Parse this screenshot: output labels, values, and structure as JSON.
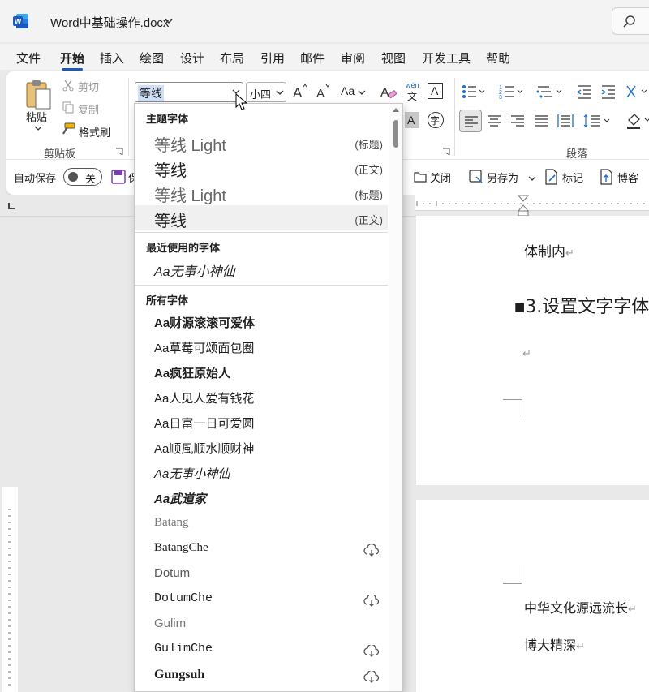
{
  "window": {
    "doc_title": "Word中基础操作.docx"
  },
  "menu": {
    "tabs": [
      "文件",
      "开始",
      "插入",
      "绘图",
      "设计",
      "布局",
      "引用",
      "邮件",
      "审阅",
      "视图",
      "开发工具",
      "帮助"
    ],
    "active_tab": "开始"
  },
  "clipboard": {
    "paste": "粘贴",
    "cut": "剪切",
    "copy": "复制",
    "format_painter": "格式刷",
    "group_label": "剪贴板"
  },
  "font": {
    "current_font": "等线",
    "current_size": "小四",
    "case_label": "Aa",
    "phonetic_top": "wén",
    "phonetic_bottom": "文",
    "border_char": "A",
    "shading_char": "A",
    "enclose_char": "字"
  },
  "paragraph": {
    "group_label": "段落"
  },
  "quickbar": {
    "autosave": "自动保存",
    "toggle_state": "关",
    "save_partial": "保",
    "close": "关闭",
    "save_as": "另存为",
    "mark": "标记",
    "blog": "博客"
  },
  "document": {
    "line1": "体制内",
    "heading": "3.设置文字字体",
    "line_para_mark": "↵",
    "line2": "中华文化源远流长",
    "line3": "博大精深"
  },
  "font_dropdown": {
    "theme_header": "主题字体",
    "theme_fonts": [
      {
        "name": "等线 Light",
        "tag": "(标题)"
      },
      {
        "name": "等线",
        "tag": "(正文)"
      },
      {
        "name": "等线 Light",
        "tag": "(标题)"
      },
      {
        "name": "等线",
        "tag": "(正文)"
      }
    ],
    "recent_header": "最近使用的字体",
    "recent_fonts": [
      "Aa无事小神仙"
    ],
    "all_header": "所有字体",
    "all_fonts": [
      {
        "name": "Aa财源滚滚可爱体",
        "cloud": false
      },
      {
        "name": "Aa草莓可颂面包圈",
        "cloud": false
      },
      {
        "name": "Aa疯狂原始人",
        "cloud": false
      },
      {
        "name": "Aa人见人爱有钱花",
        "cloud": false
      },
      {
        "name": "Aa日富一日可爱圆",
        "cloud": false
      },
      {
        "name": "Aa顺風顺水顺财神",
        "cloud": false
      },
      {
        "name": "Aa无事小神仙",
        "cloud": false
      },
      {
        "name": "Aa武道家",
        "cloud": false
      },
      {
        "name": "Batang",
        "cloud": false
      },
      {
        "name": "BatangChe",
        "cloud": true
      },
      {
        "name": "Dotum",
        "cloud": false
      },
      {
        "name": "DotumChe",
        "cloud": true
      },
      {
        "name": "Gulim",
        "cloud": false
      },
      {
        "name": "GulimChe",
        "cloud": true
      },
      {
        "name": "Gungsuh",
        "cloud": true
      }
    ]
  },
  "colors": {
    "accent": "#185abd",
    "word_blue": "#2b579a"
  }
}
